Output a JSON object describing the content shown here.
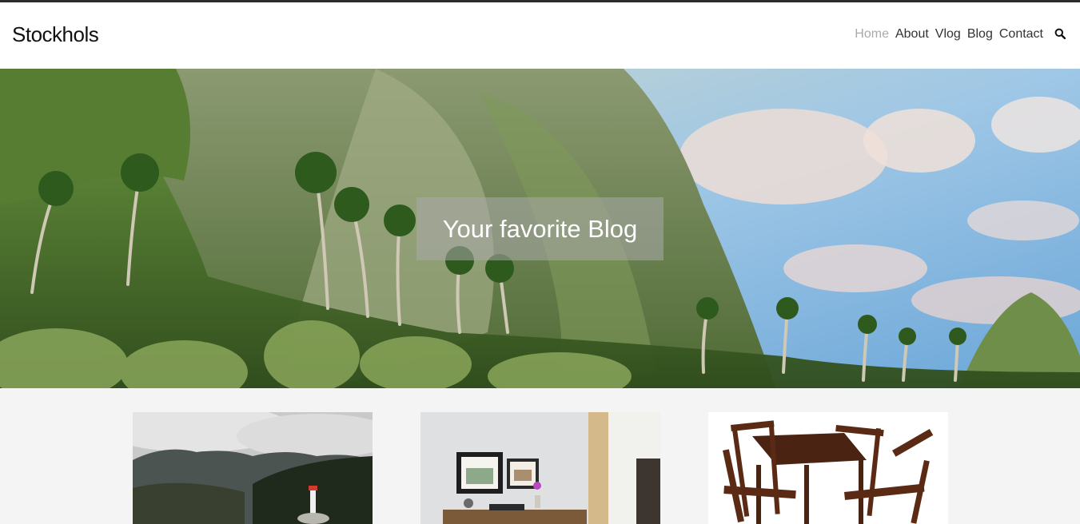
{
  "site": {
    "title": "Stockhols"
  },
  "nav": {
    "items": [
      {
        "label": "Home",
        "active": true
      },
      {
        "label": "About",
        "active": false
      },
      {
        "label": "Vlog",
        "active": false
      },
      {
        "label": "Blog",
        "active": false
      },
      {
        "label": "Contact",
        "active": false
      }
    ],
    "search_icon": "search-icon"
  },
  "hero": {
    "banner_text": "Your favorite Blog"
  },
  "cards": [
    {
      "image": "lighthouse-mountain-photo"
    },
    {
      "image": "home-office-interior-photo"
    },
    {
      "image": "wooden-table-chairs-photo"
    }
  ],
  "colors": {
    "nav_active": "#aaaaaa",
    "nav_text": "#333333",
    "background": "#f4f4f4"
  }
}
